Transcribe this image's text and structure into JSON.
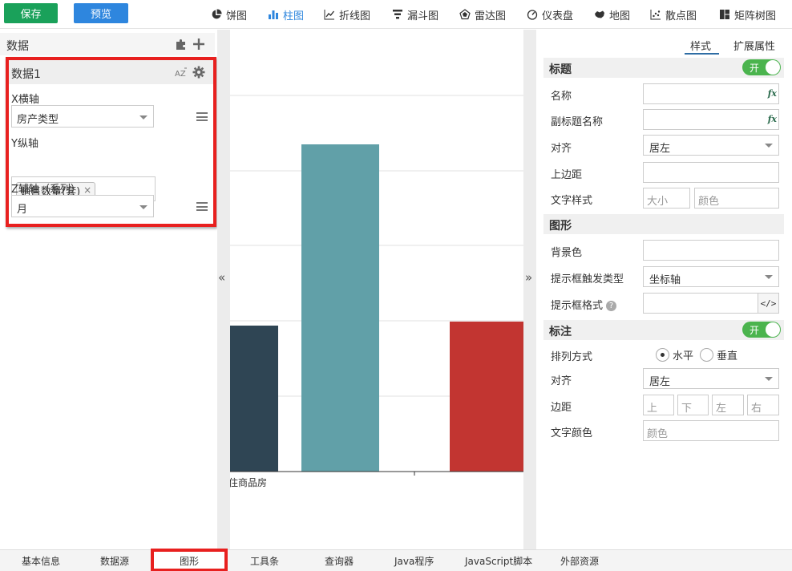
{
  "toolbar": {
    "save_label": "保存",
    "preview_label": "预览",
    "chart_types": [
      "饼图",
      "柱图",
      "折线图",
      "漏斗图",
      "雷达图",
      "仪表盘",
      "地图",
      "散点图",
      "矩阵树图"
    ],
    "active_chart_type": "柱图",
    "accent_color": "#2e86de"
  },
  "left_panel": {
    "title": "数据",
    "dataset": {
      "name": "数据1",
      "x_axis_label": "X横轴",
      "x_axis_value": "房产类型",
      "y_axis_label": "Y纵轴",
      "y_axis_tag": "销售数量(套)",
      "z_axis_label": "Z辅轴（系列）",
      "z_axis_value": "月"
    }
  },
  "chart_data": {
    "type": "bar",
    "categories": [
      "住商品房"
    ],
    "visible_bar_colors": [
      "#2f4554",
      "#61a0a8",
      "#c23531"
    ],
    "visible_category_label": "住商品房",
    "grid": true
  },
  "right_panel": {
    "tabs": [
      "样式",
      "扩展属性"
    ],
    "active_tab": "样式",
    "title_section": {
      "label": "标题",
      "toggle": "开",
      "name_label": "名称",
      "subtitle_label": "副标题名称",
      "align_label": "对齐",
      "align_value": "居左",
      "top_margin_label": "上边距",
      "text_style_label": "文字样式",
      "size_placeholder": "大小",
      "color_placeholder": "颜色"
    },
    "graphic_section": {
      "label": "图形",
      "bg_color_label": "背景色",
      "tooltip_trigger_label": "提示框触发类型",
      "tooltip_trigger_value": "坐标轴",
      "tooltip_format_label": "提示框格式",
      "code_button": "</>"
    },
    "label_section": {
      "label": "标注",
      "toggle": "开",
      "layout_label": "排列方式",
      "horizontal": "水平",
      "vertical": "垂直",
      "align_label": "对齐",
      "align_value": "居左",
      "margin_label": "边距",
      "margin_placeholders": [
        "上",
        "下",
        "左",
        "右"
      ],
      "text_color_label": "文字颜色",
      "text_color_placeholder": "颜色"
    }
  },
  "bottom_tabs": [
    "基本信息",
    "数据源",
    "图形",
    "工具条",
    "查询器",
    "Java程序",
    "JavaScript脚本",
    "外部资源"
  ],
  "active_bottom_tab": "图形",
  "splitter": {
    "left_arrow": "«",
    "right_arrow": "»"
  }
}
